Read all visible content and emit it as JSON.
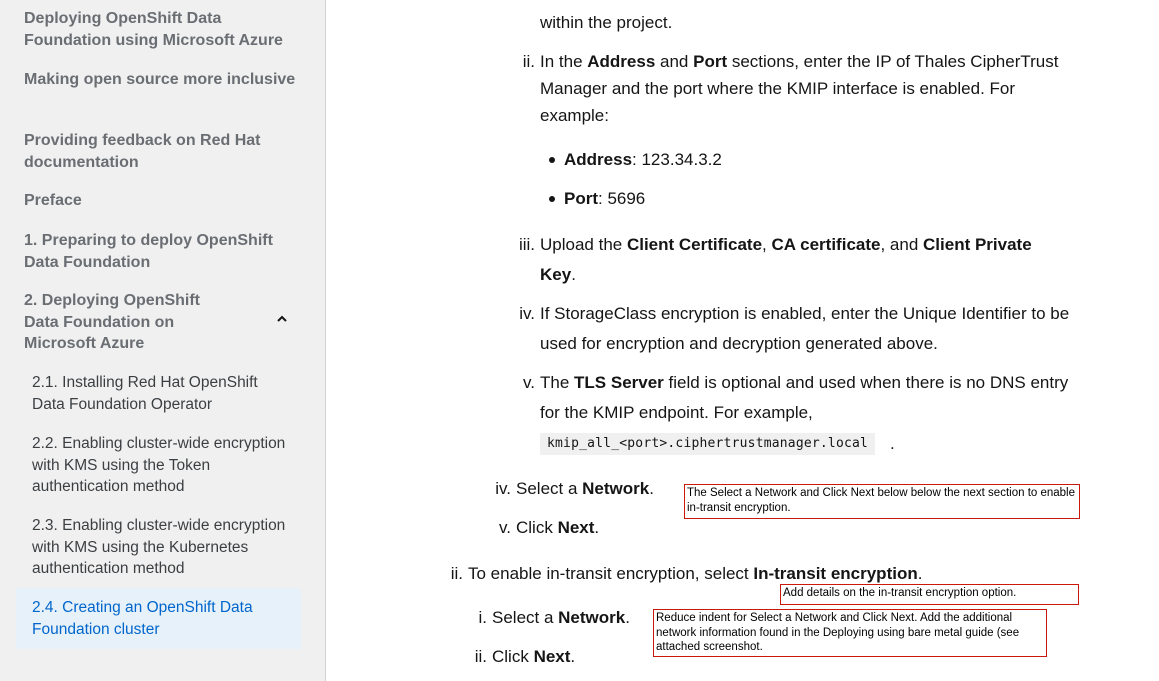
{
  "sidebar": {
    "items": [
      {
        "label": "Deploying OpenShift Data Foundation using Microsoft Azure"
      },
      {
        "label": "Making open source more inclusive"
      },
      {
        "label": "Providing feedback on Red Hat documentation"
      },
      {
        "label": "Preface"
      },
      {
        "label": "1. Preparing to deploy OpenShift Data Foundation"
      },
      {
        "label": "2. Deploying OpenShift Data Foundation on Microsoft Azure"
      }
    ],
    "subitems": [
      {
        "label": "2.1. Installing Red Hat OpenShift Data Foundation Operator"
      },
      {
        "label": "2.2. Enabling cluster-wide encryption with KMS using the Token authentication method"
      },
      {
        "label": "2.3. Enabling cluster-wide encryption with KMS using the Kubernetes authentication method"
      },
      {
        "label": "2.4. Creating an OpenShift Data Foundation cluster"
      }
    ],
    "toggle_icon": "chevron-up-icon"
  },
  "content": {
    "line_top": "within the project.",
    "step_ii": {
      "num": "ii.",
      "t1": "In the ",
      "b1": "Address",
      "t2": " and ",
      "b2": "Port",
      "t3": " sections, enter the IP of Thales CipherTrust",
      "line2": "Manager and the port where the KMIP interface is enabled. For",
      "line3": "example:"
    },
    "bullets": [
      {
        "key": "Address",
        "value": ": 123.34.3.2"
      },
      {
        "key": "Port",
        "value": ": 5696"
      }
    ],
    "step_iii": {
      "num": "iii.",
      "t1": "Upload the ",
      "b1": "Client Certificate",
      "t2": ", ",
      "b2": "CA certificate",
      "t3": ", and ",
      "b3": "Client Private",
      "b4": "Key",
      "t4": "."
    },
    "step_iv": {
      "num": "iv.",
      "line1": "If StorageClass encryption is enabled, enter the Unique Identifier to be",
      "line2": "used for encryption and decryption generated above."
    },
    "step_v": {
      "num": "v.",
      "t1": "The ",
      "b1": "TLS Server",
      "t2": " field is optional and used when there is no DNS entry",
      "line2": "for the KMIP endpoint. For example,",
      "code": "kmip_all_<port>.ciphertrustmanager.local",
      "after_code": "."
    },
    "outer_iv": {
      "num": "iv.",
      "t1": "Select a ",
      "b1": "Network",
      "t2": "."
    },
    "outer_v": {
      "num": "v.",
      "t1": "Click ",
      "b1": "Next",
      "t2": "."
    },
    "transit": {
      "num": "ii.",
      "t1": "To enable in-transit encryption, select ",
      "b1": "In-transit encryption",
      "t2": "."
    },
    "transit_i": {
      "num": "i.",
      "t1": "Select a ",
      "b1": "Network",
      "t2": "."
    },
    "transit_ii": {
      "num": "ii.",
      "t1": "Click ",
      "b1": "Next",
      "t2": "."
    }
  },
  "notes": {
    "note1": "The Select a Network and Click Next below below the next section to enable in-transit encryption.",
    "note2": "Add details on the in-transit encryption option.",
    "note3": "Reduce indent for Select a Network and Click Next.  Add the additional network information found in the Deploying using bare metal guide (see attached screenshot."
  },
  "colors": {
    "sidebar_bg": "#f0f0f0",
    "active_bg": "#e7f1fa",
    "link": "#0066cc",
    "note_border": "#c9190b"
  }
}
